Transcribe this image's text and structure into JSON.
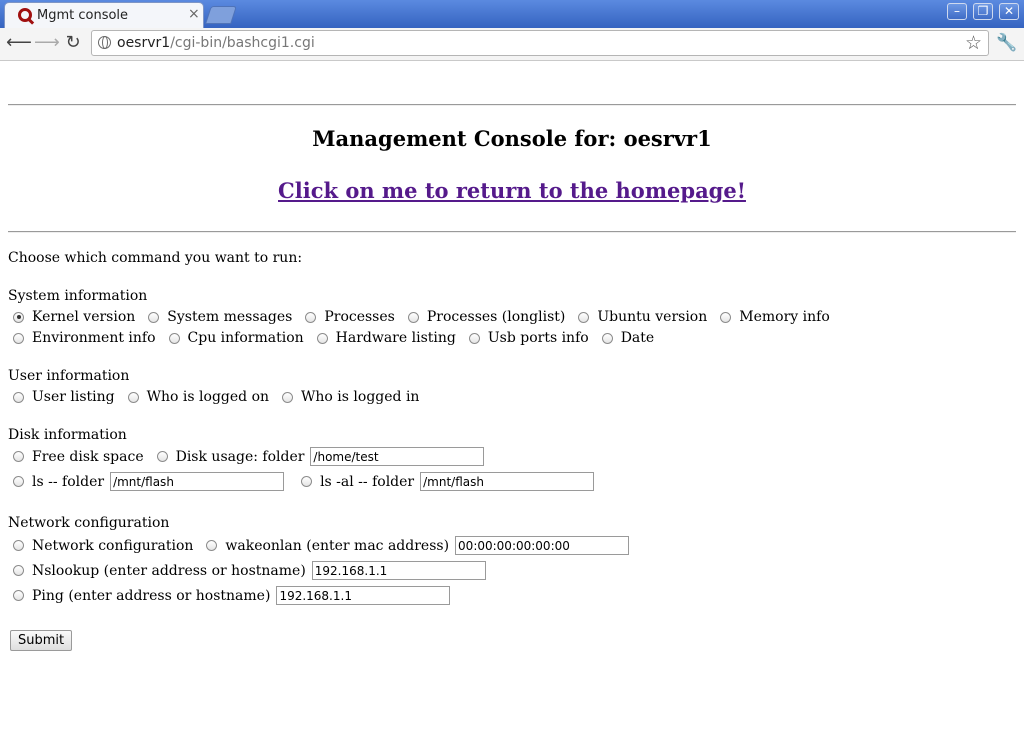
{
  "browser": {
    "tab_title": "Mgmt console",
    "tab_close": "×",
    "url_host": "oesrvr1",
    "url_path": "/cgi-bin/bashcgi1.cgi"
  },
  "page": {
    "heading": "Management Console for: oesrvr1",
    "home_link": "Click on me to return to the homepage!",
    "intro": "Choose which command you want to run:",
    "sections": {
      "system": {
        "title": "System information",
        "options": [
          "Kernel version",
          "System messages",
          "Processes",
          "Processes (longlist)",
          "Ubuntu version",
          "Memory info",
          "Environment info",
          "Cpu information",
          "Hardware listing",
          "Usb ports info",
          "Date"
        ],
        "selected": "Kernel version"
      },
      "user": {
        "title": "User information",
        "options": [
          "User listing",
          "Who is logged on",
          "Who is logged in"
        ]
      },
      "disk": {
        "title": "Disk information",
        "options": [
          "Free disk space",
          "Disk usage: folder",
          "ls -- folder",
          "ls -al -- folder"
        ],
        "disk_usage_folder": "/home/test",
        "ls_folder": "/mnt/flash",
        "ls_al_folder": "/mnt/flash"
      },
      "network": {
        "title": "Network configuration",
        "options": [
          "Network configuration",
          "wakeonlan (enter mac address)",
          "Nslookup (enter address or hostname)",
          "Ping (enter address or hostname)"
        ],
        "mac_address": "00:00:00:00:00:00",
        "nslookup_host": "192.168.1.1",
        "ping_host": "192.168.1.1"
      }
    },
    "submit_label": "Submit"
  }
}
